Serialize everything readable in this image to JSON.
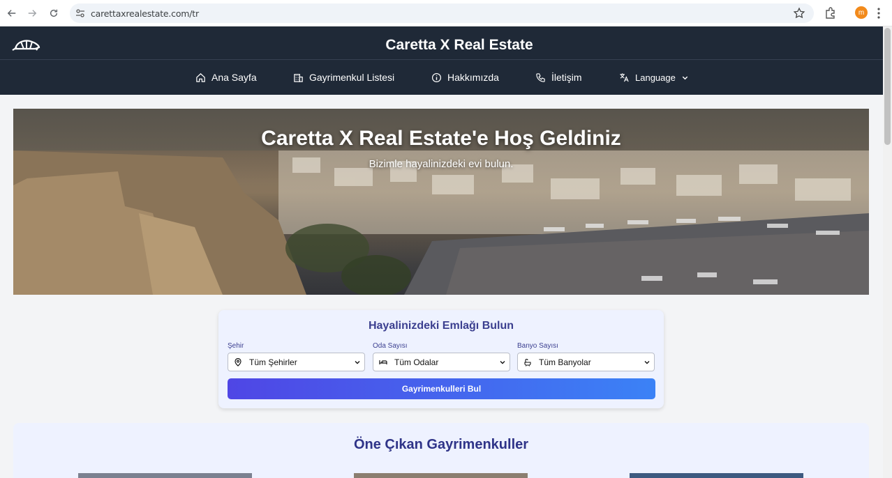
{
  "browser": {
    "url": "carettaxrealestate.com/tr",
    "profile_initial": "m"
  },
  "header": {
    "title": "Caretta X Real Estate",
    "menu": {
      "home": "Ana Sayfa",
      "listings": "Gayrimenkul Listesi",
      "about": "Hakkımızda",
      "contact": "İletişim",
      "language": "Language"
    }
  },
  "hero": {
    "title": "Caretta X Real Estate'e Hoş Geldiniz",
    "subtitle": "Bizimle hayalinizdeki evi bulun."
  },
  "search": {
    "title": "Hayalinizdeki Emlağı Bulun",
    "city_label": "Şehir",
    "city_value": "Tüm Şehirler",
    "rooms_label": "Oda Sayısı",
    "rooms_value": "Tüm Odalar",
    "baths_label": "Banyo Sayısı",
    "baths_value": "Tüm Banyolar",
    "button": "Gayrimenkulleri Bul"
  },
  "featured": {
    "title": "Öne Çıkan Gayrimenkuller"
  },
  "icons": {
    "back": "arrow-left-icon",
    "forward": "arrow-right-icon",
    "reload": "reload-icon",
    "site_info": "tune-icon",
    "bookmark": "star-icon",
    "extensions": "puzzle-icon",
    "menu": "kebab-icon",
    "home": "home-icon",
    "listings": "building-icon",
    "about": "info-icon",
    "contact": "phone-icon",
    "language": "translate-icon"
  },
  "colors": {
    "header_bg": "#1f2937",
    "accent": "#3b3f8f",
    "button_start": "#4f46e5",
    "button_end": "#3b82f6"
  }
}
